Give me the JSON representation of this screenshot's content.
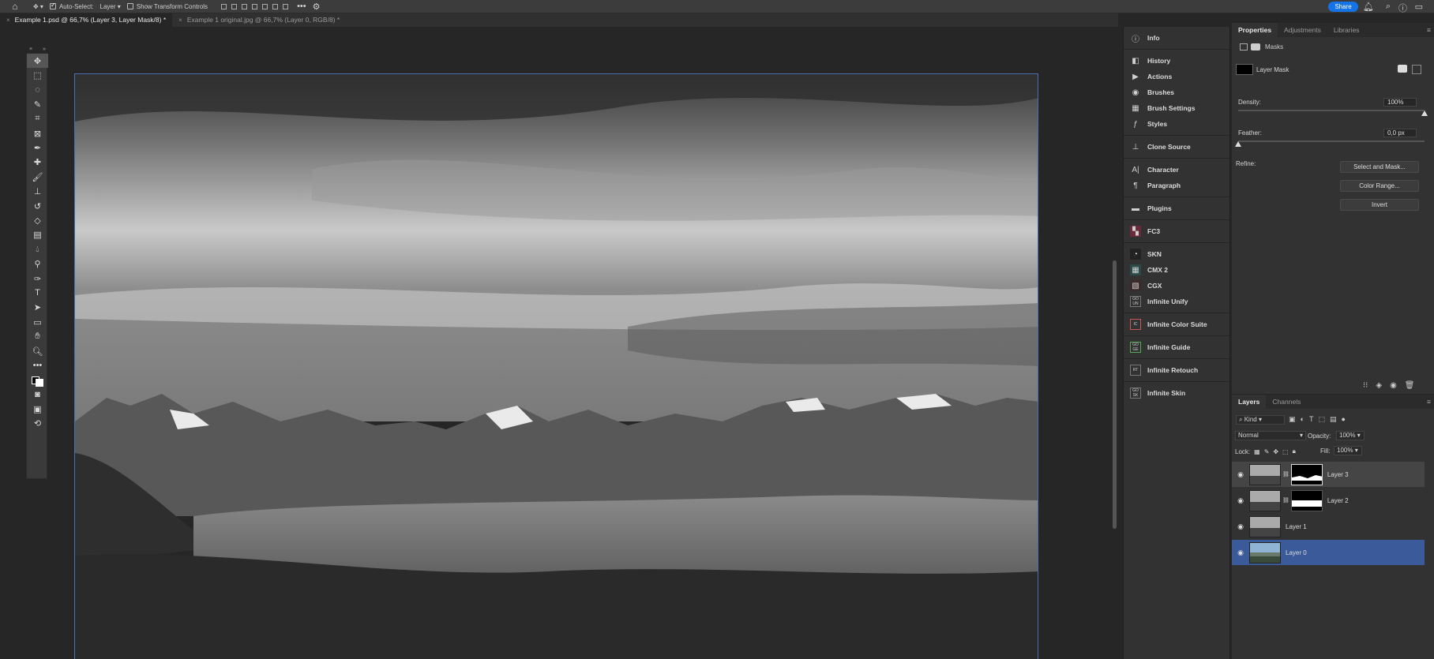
{
  "options_bar": {
    "auto_select_label": "Auto-Select:",
    "auto_select_value": "Layer",
    "transform_label": "Show Transform Controls",
    "share_label": "Share"
  },
  "tabs": [
    {
      "label": "Example 1.psd @ 66,7% (Layer 3, Layer Mask/8) *",
      "active": true
    },
    {
      "label": "Example 1 original.jpg @ 66,7% (Layer 0, RGB/8) *",
      "active": false
    }
  ],
  "panel_dock": {
    "items": [
      {
        "label": "Info",
        "icon": "info-icon"
      },
      {
        "label": "History",
        "icon": "history-icon"
      },
      {
        "label": "Actions",
        "icon": "actions-icon"
      },
      {
        "label": "Brushes",
        "icon": "brushes-icon"
      },
      {
        "label": "Brush Settings",
        "icon": "brush-settings-icon"
      },
      {
        "label": "Styles",
        "icon": "styles-icon"
      },
      {
        "label": "Clone Source",
        "icon": "clone-source-icon"
      },
      {
        "label": "Character",
        "icon": "character-icon"
      },
      {
        "label": "Paragraph",
        "icon": "paragraph-icon"
      },
      {
        "label": "Plugins",
        "icon": "plugins-icon"
      },
      {
        "label": "FC3",
        "icon": "fc3-plugin-icon"
      },
      {
        "label": "SKN",
        "icon": "skn-plugin-icon"
      },
      {
        "label": "CMX 2",
        "icon": "cmx2-plugin-icon"
      },
      {
        "label": "CGX",
        "icon": "cgx-plugin-icon"
      },
      {
        "label": "Infinite Unify",
        "icon": "infinite-unify-icon"
      },
      {
        "label": "Infinite Color Suite",
        "icon": "infinite-color-suite-icon"
      },
      {
        "label": "Infinite Guide",
        "icon": "infinite-guide-icon"
      },
      {
        "label": "Infinite Retouch",
        "icon": "infinite-retouch-icon"
      },
      {
        "label": "Infinite Skin",
        "icon": "infinite-skin-icon"
      }
    ],
    "plugin_badges": {
      "unify": "GO UN",
      "color": "IC",
      "guide": "GO GE",
      "retouch": "RT",
      "skin": "GO SK"
    }
  },
  "properties": {
    "tabs": [
      "Properties",
      "Adjustments",
      "Libraries"
    ],
    "masks_label": "Masks",
    "layer_mask_label": "Layer Mask",
    "density_label": "Density:",
    "density_value": "100%",
    "density_fraction": 1.0,
    "feather_label": "Feather:",
    "feather_value": "0,0 px",
    "feather_fraction": 0.0,
    "refine_label": "Refine:",
    "select_mask_btn": "Select and Mask...",
    "color_range_btn": "Color Range...",
    "invert_btn": "Invert"
  },
  "layers_panel": {
    "tabs": [
      "Layers",
      "Channels"
    ],
    "kind_label": "Kind",
    "blend_mode": "Normal",
    "opacity_label": "Opacity:",
    "opacity_value": "100%",
    "lock_label": "Lock:",
    "fill_label": "Fill:",
    "fill_value": "100%",
    "layers": [
      {
        "name": "Layer 3",
        "has_mask": true,
        "state": "selected"
      },
      {
        "name": "Layer 2",
        "has_mask": true,
        "state": "normal"
      },
      {
        "name": "Layer 1",
        "has_mask": false,
        "state": "normal"
      },
      {
        "name": "Layer 0",
        "has_mask": false,
        "state": "active"
      }
    ]
  }
}
